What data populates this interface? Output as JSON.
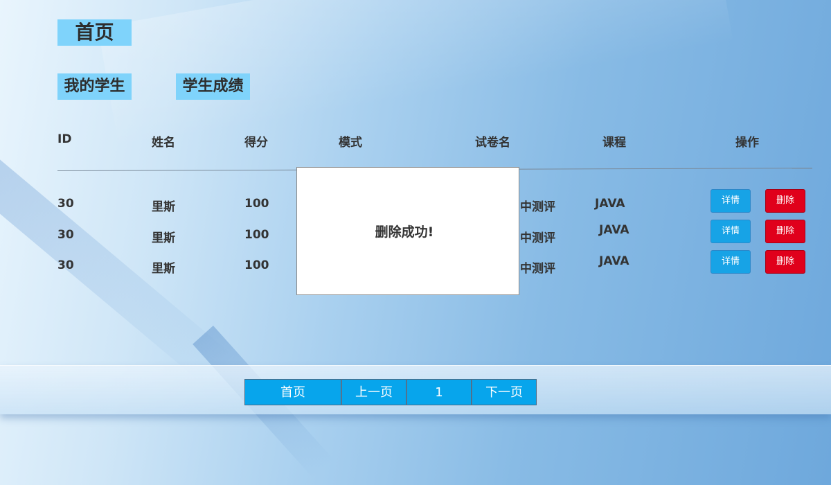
{
  "header": {
    "title": "首页"
  },
  "nav": {
    "tabs": [
      {
        "label": "我的学生"
      },
      {
        "label": "学生成绩"
      }
    ]
  },
  "table": {
    "columns": [
      "ID",
      "姓名",
      "得分",
      "模式",
      "试卷名",
      "课程",
      "操作"
    ],
    "rows": [
      {
        "id": "30",
        "name": "里斯",
        "score": "100",
        "paper": "中测评",
        "course": "JAVA",
        "detail": "详情",
        "delete": "删除"
      },
      {
        "id": "30",
        "name": "里斯",
        "score": "100",
        "paper": "中测评",
        "course": "JAVA",
        "detail": "详情",
        "delete": "删除"
      },
      {
        "id": "30",
        "name": "里斯",
        "score": "100",
        "paper": "中测评",
        "course": "JAVA",
        "detail": "详情",
        "delete": "删除"
      }
    ]
  },
  "dialog": {
    "message": "删除成功!"
  },
  "pagination": {
    "first": "首页",
    "prev": "上一页",
    "current": "1",
    "next": "下一页"
  },
  "colors": {
    "tab_bg": "#7fd3fb",
    "detail_button": "#17a3e6",
    "delete_button": "#e0001b",
    "pagination_bg": "#07a5ec"
  }
}
